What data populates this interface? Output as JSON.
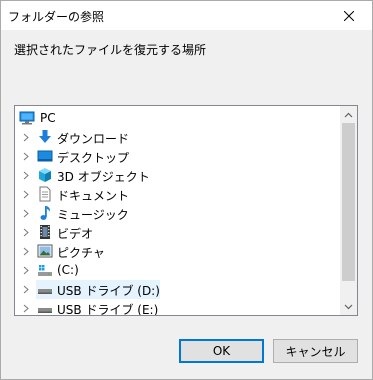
{
  "window": {
    "title": "フォルダーの参照"
  },
  "instruction": "選択されたファイルを復元する場所",
  "tree": {
    "items": [
      {
        "label": "PC",
        "icon": "pc-icon"
      },
      {
        "label": "ダウンロード",
        "icon": "download-folder-icon"
      },
      {
        "label": "デスクトップ",
        "icon": "desktop-folder-icon"
      },
      {
        "label": "3D オブジェクト",
        "icon": "3d-objects-folder-icon"
      },
      {
        "label": "ドキュメント",
        "icon": "documents-folder-icon"
      },
      {
        "label": "ミュージック",
        "icon": "music-folder-icon"
      },
      {
        "label": "ビデオ",
        "icon": "videos-folder-icon"
      },
      {
        "label": "ピクチャ",
        "icon": "pictures-folder-icon"
      },
      {
        "label": "(C:)",
        "icon": "windows-drive-icon"
      },
      {
        "label": "USB ドライブ (D:)",
        "icon": "usb-drive-icon",
        "selected": true
      },
      {
        "label": "USB ドライブ (E:)",
        "icon": "usb-drive-icon"
      }
    ]
  },
  "buttons": {
    "ok": "OK",
    "cancel": "キャンセル"
  },
  "colors": {
    "accent": "#0078d7",
    "selection": "#e5f3ff"
  }
}
